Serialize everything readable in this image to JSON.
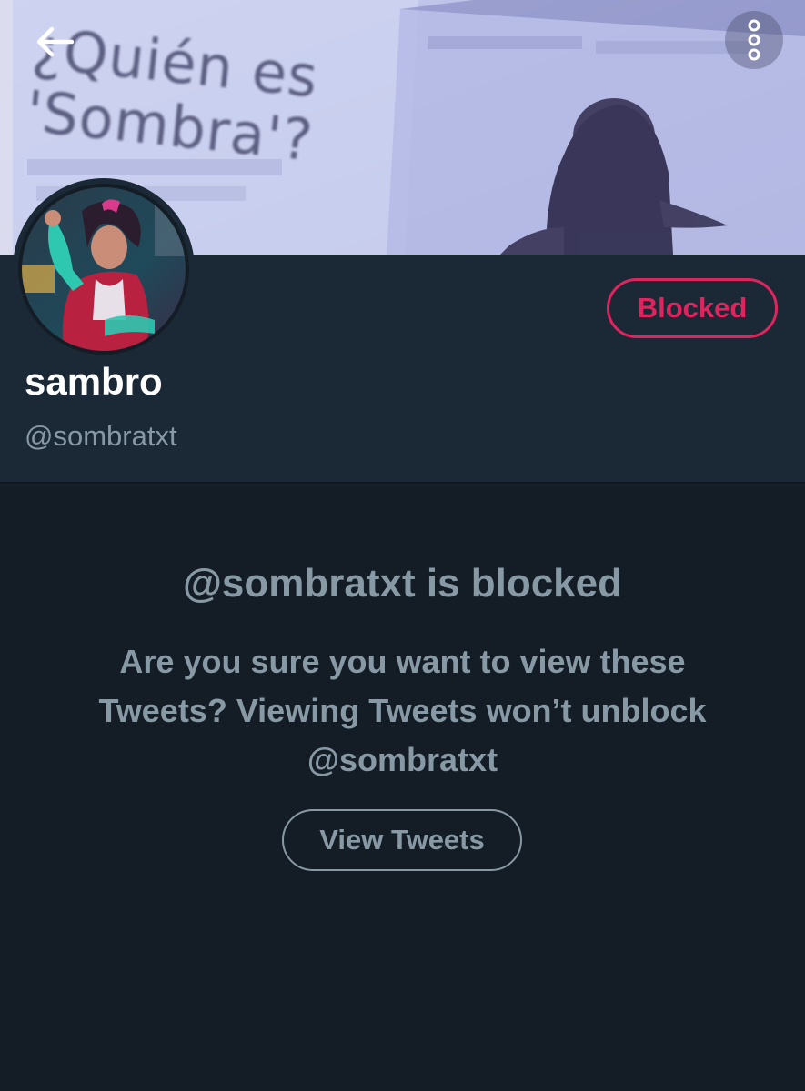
{
  "banner": {
    "photo_text": "¿Quién es\n'Sombra'?",
    "back_icon": "arrow-left-icon",
    "more_icon": "more-vertical-icon"
  },
  "profile": {
    "display_name": "sambro",
    "handle": "@sombratxt",
    "blocked_label": "Blocked",
    "avatar_icon": "avatar-image"
  },
  "notice": {
    "title": "@sombratxt is blocked",
    "body": "Are you sure you want to view these Tweets? Viewing Tweets won’t unblock @sombratxt",
    "view_button_label": "View Tweets"
  },
  "colors": {
    "blocked_accent": "#e0245e",
    "header_bg": "#1b2836",
    "page_bg": "#141d26",
    "muted_text": "#8899a6"
  }
}
